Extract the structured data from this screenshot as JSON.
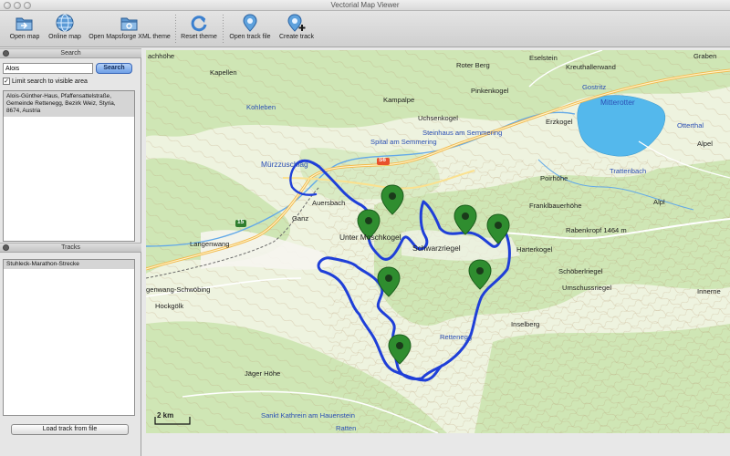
{
  "window": {
    "title": "Vectorial Map Viewer"
  },
  "toolbar": {
    "open_map": "Open map",
    "online_map": "Online map",
    "open_theme": "Open Mapsforge XML theme",
    "reset_theme": "Reset theme",
    "open_track": "Open track file",
    "create_track": "Create track"
  },
  "search": {
    "header": "Search",
    "value": "Alois",
    "button": "Search",
    "limit_label": "Limit search to visible area",
    "limit_checked": "✓",
    "results": [
      "Alois-Günther-Haus, Pfaffensattelstraße, Gemeinde Rettenegg, Bezirk Weiz, Styria, 8674, Austria"
    ]
  },
  "tracks": {
    "header": "Tracks",
    "items": [
      "Stuhleck-Marathon-Strecke"
    ],
    "load_button": "Load track from file"
  },
  "map": {
    "scale_label": "2 km",
    "road_number": "S6",
    "road_number_2": "15",
    "labels": [
      "achhöhe",
      "Kapellen",
      "Kohleben",
      "Mürzzuschlag",
      "Spital am Semmering",
      "Kampalpe",
      "Uchsenkogel",
      "Steinhaus am Semmering",
      "Roter Berg",
      "Pinkenkogel",
      "Eselstein",
      "Kreuthallerwand",
      "Gostritz",
      "Graben",
      "Mitterotter",
      "Erzkogel",
      "Otterthal",
      "Alpel",
      "Trattenbach",
      "Poirhöhe",
      "Alpl",
      "Franklbauerhöhe",
      "Auersbach",
      "Ganz",
      "Unter Moschkogel",
      "Schwarzriegel",
      "Rabenkropf 1464 m",
      "Harterkogel",
      "Langenwang",
      "genwang-Schwöbing",
      "Schöberlriegel",
      "Umschussriegel",
      "Innerne",
      "Hockgölk",
      "Inselberg",
      "Rettenegg",
      "Jäger Höhe",
      "Sankt Kathrein am Hauenstein",
      "Ratten"
    ]
  },
  "colors": {
    "track": "#1f3fd8",
    "marker": "#2f8d2f",
    "water": "#54b8ec",
    "forest": "#cfe6b5",
    "meadow": "#eef3df"
  }
}
